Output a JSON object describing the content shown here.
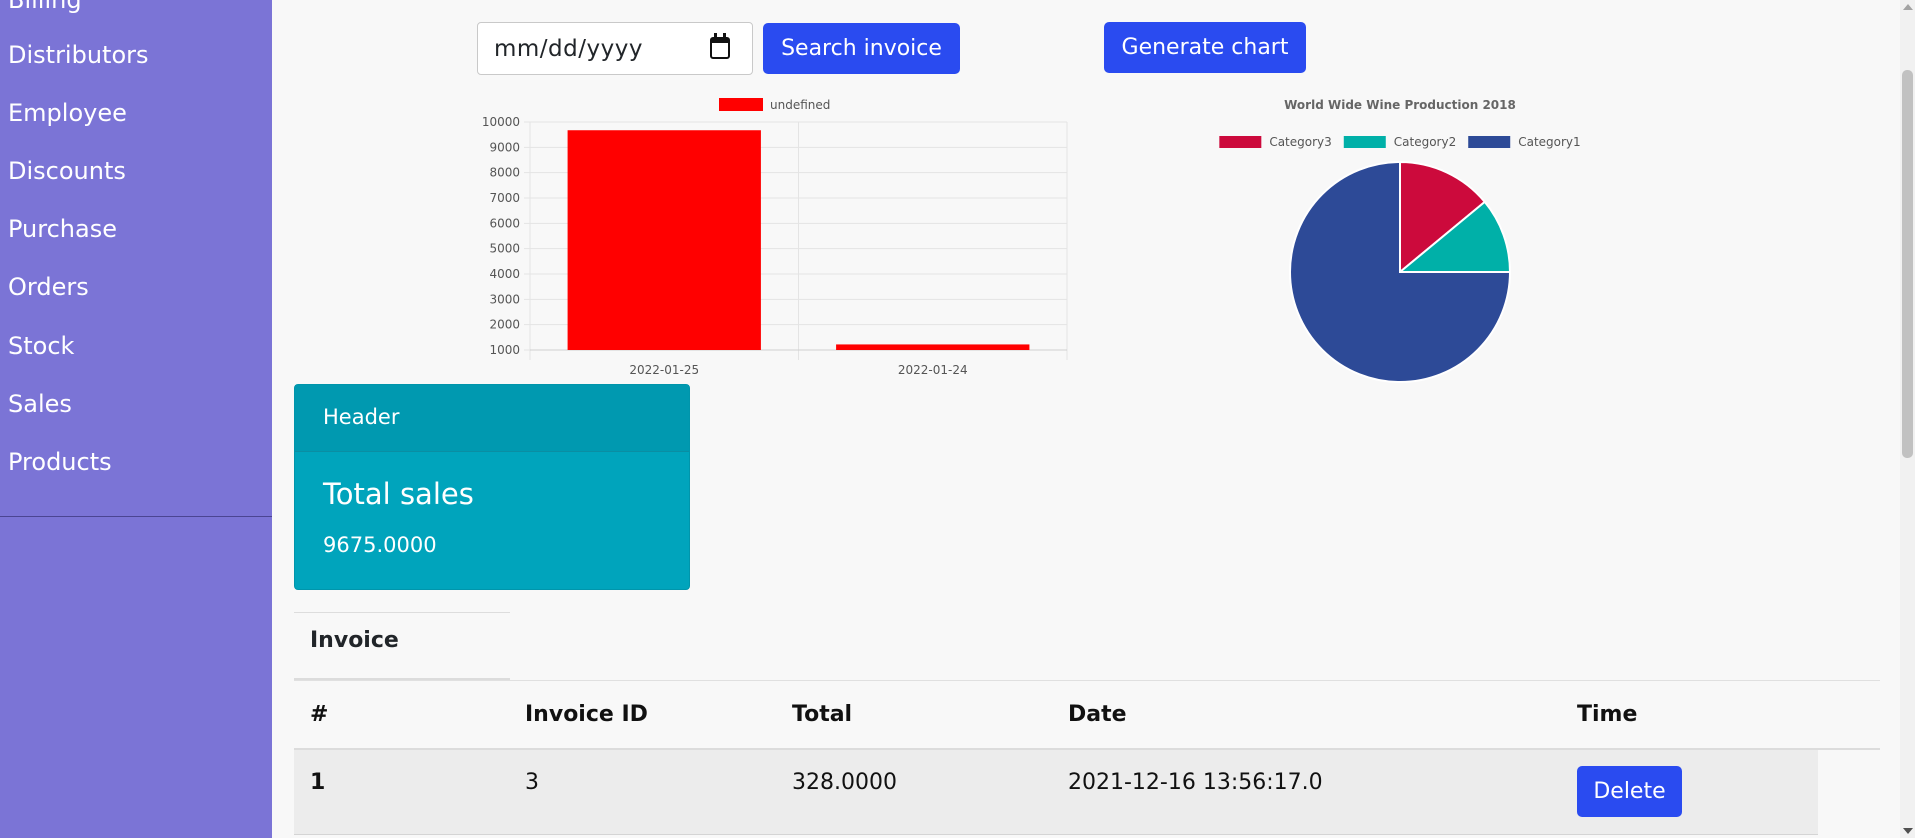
{
  "sidebar": {
    "items": [
      {
        "label": "Billing"
      },
      {
        "label": "Distributors"
      },
      {
        "label": "Employee"
      },
      {
        "label": "Discounts"
      },
      {
        "label": "Purchase"
      },
      {
        "label": "Orders"
      },
      {
        "label": "Stock"
      },
      {
        "label": "Sales"
      },
      {
        "label": "Products"
      }
    ]
  },
  "controls": {
    "date_placeholder": "mm/dd/yyyy",
    "search_label": "Search invoice",
    "generate_label": "Generate chart"
  },
  "chart_data": [
    {
      "type": "bar",
      "title": "",
      "categories": [
        "2022-01-25",
        "2022-01-24"
      ],
      "series": [
        {
          "name": "undefined",
          "values": [
            9675,
            1220
          ],
          "color": "#ff0000"
        }
      ],
      "ylim": [
        1000,
        10000
      ],
      "yticks": [
        1000,
        2000,
        3000,
        4000,
        5000,
        6000,
        7000,
        8000,
        9000,
        10000
      ],
      "grid": true,
      "legend": "top"
    },
    {
      "type": "pie",
      "title": "World Wide Wine Production 2018",
      "legend": "top",
      "slices": [
        {
          "name": "Category3",
          "value": 14,
          "color": "#cc0a3c"
        },
        {
          "name": "Category2",
          "value": 11,
          "color": "#00b0a8"
        },
        {
          "name": "Category1",
          "value": 75,
          "color": "#2d4a97"
        }
      ]
    }
  ],
  "card": {
    "header": "Header",
    "title": "Total sales",
    "value": "9675.0000"
  },
  "tabs": [
    {
      "label": "Invoice"
    }
  ],
  "table": {
    "columns": [
      "#",
      "Invoice ID",
      "Total",
      "Date",
      "Time"
    ],
    "rows": [
      {
        "num": "1",
        "invoice_id": "3",
        "total": "328.0000",
        "date": "2021-12-16 13:56:17.0",
        "action": "Delete"
      }
    ]
  },
  "colors": {
    "sidebar": "#7b74d6",
    "primary_button": "#2a4bf0",
    "card": "#00a4bc"
  }
}
